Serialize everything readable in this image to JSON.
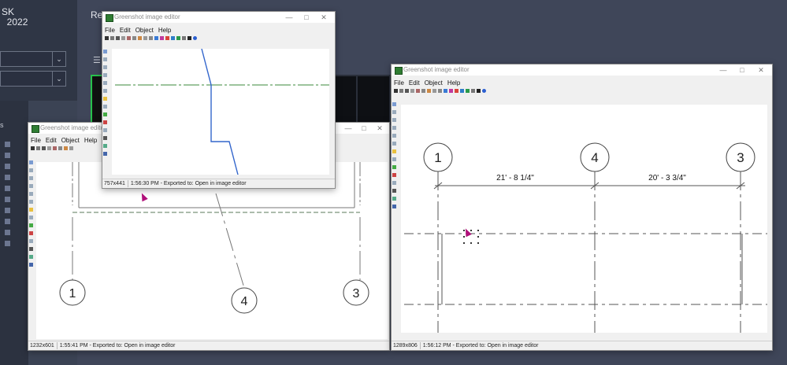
{
  "background": {
    "app_title": "SK\n  2022",
    "recent_label": "Re"
  },
  "editor_title": "Greenshot image editor",
  "menu": [
    "File",
    "Edit",
    "Object",
    "Help"
  ],
  "windows": {
    "top": {
      "status_size": "757x441",
      "status_message": "1:56:30 PM - Exported to: Open in image editor"
    },
    "left": {
      "status_size": "1232x601",
      "status_message": "1:55:41 PM - Exported to: Open in image editor",
      "grid_labels": [
        "1",
        "4",
        "3"
      ]
    },
    "right": {
      "status_size": "1289x806",
      "status_message": "1:56:12 PM - Exported to: Open in image editor",
      "grid_labels": [
        "1",
        "4",
        "3"
      ],
      "dimensions": [
        "21' - 8 1/4\"",
        "20' - 3 3/4\""
      ]
    }
  },
  "colors": {
    "accent_green": "#27c24c",
    "plan_blue": "#3366cc",
    "cursor_magenta": "#b0107a"
  }
}
